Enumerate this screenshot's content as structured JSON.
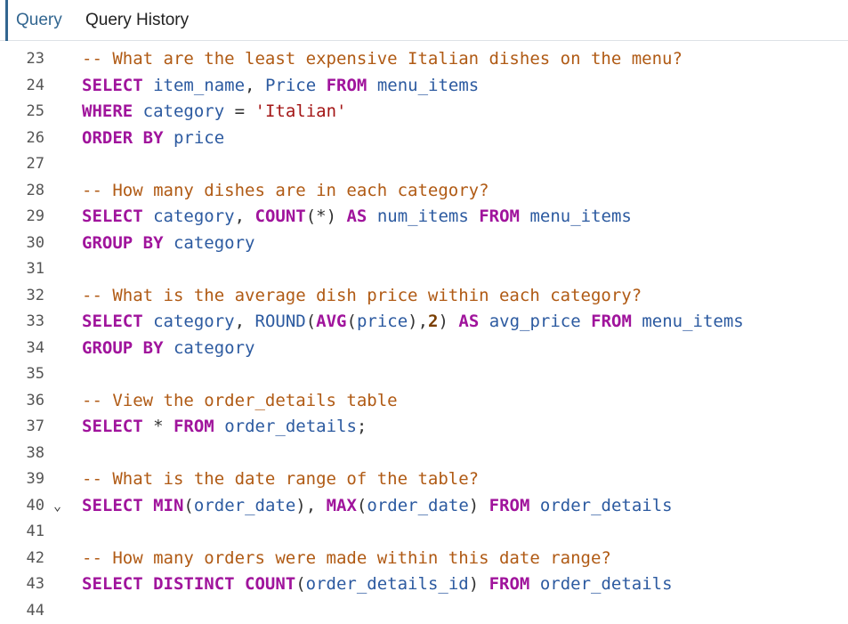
{
  "tabs": [
    {
      "label": "Query",
      "active": true
    },
    {
      "label": "Query History",
      "active": false
    }
  ],
  "colors": {
    "accent": "#326690",
    "comment": "#b05a14",
    "keyword": "#a0149c",
    "identifier": "#2c5aa0",
    "string": "#a31515"
  },
  "editor": {
    "lines": [
      {
        "num": "23",
        "tokens": [
          {
            "t": "comment",
            "v": "-- What are the least expensive Italian dishes on the menu?"
          }
        ]
      },
      {
        "num": "24",
        "tokens": [
          {
            "t": "keyword",
            "v": "SELECT"
          },
          {
            "t": "punct",
            "v": " "
          },
          {
            "t": "ident",
            "v": "item_name"
          },
          {
            "t": "punct",
            "v": ", "
          },
          {
            "t": "ident",
            "v": "Price"
          },
          {
            "t": "punct",
            "v": " "
          },
          {
            "t": "keyword",
            "v": "FROM"
          },
          {
            "t": "punct",
            "v": " "
          },
          {
            "t": "ident",
            "v": "menu_items"
          }
        ]
      },
      {
        "num": "25",
        "tokens": [
          {
            "t": "keyword",
            "v": "WHERE"
          },
          {
            "t": "punct",
            "v": " "
          },
          {
            "t": "ident",
            "v": "category"
          },
          {
            "t": "punct",
            "v": " = "
          },
          {
            "t": "string",
            "v": "'Italian'"
          }
        ]
      },
      {
        "num": "26",
        "tokens": [
          {
            "t": "keyword",
            "v": "ORDER BY"
          },
          {
            "t": "punct",
            "v": " "
          },
          {
            "t": "ident",
            "v": "price"
          }
        ]
      },
      {
        "num": "27",
        "tokens": []
      },
      {
        "num": "28",
        "tokens": [
          {
            "t": "comment",
            "v": "-- How many dishes are in each category?"
          }
        ]
      },
      {
        "num": "29",
        "tokens": [
          {
            "t": "keyword",
            "v": "SELECT"
          },
          {
            "t": "punct",
            "v": " "
          },
          {
            "t": "ident",
            "v": "category"
          },
          {
            "t": "punct",
            "v": ", "
          },
          {
            "t": "keyword",
            "v": "COUNT"
          },
          {
            "t": "punct",
            "v": "(*) "
          },
          {
            "t": "keyword",
            "v": "AS"
          },
          {
            "t": "punct",
            "v": " "
          },
          {
            "t": "ident",
            "v": "num_items"
          },
          {
            "t": "punct",
            "v": " "
          },
          {
            "t": "keyword",
            "v": "FROM"
          },
          {
            "t": "punct",
            "v": " "
          },
          {
            "t": "ident",
            "v": "menu_items"
          }
        ]
      },
      {
        "num": "30",
        "tokens": [
          {
            "t": "keyword",
            "v": "GROUP BY"
          },
          {
            "t": "punct",
            "v": " "
          },
          {
            "t": "ident",
            "v": "category"
          }
        ]
      },
      {
        "num": "31",
        "tokens": []
      },
      {
        "num": "32",
        "tokens": [
          {
            "t": "comment",
            "v": "-- What is the average dish price within each category?"
          }
        ]
      },
      {
        "num": "33",
        "tokens": [
          {
            "t": "keyword",
            "v": "SELECT"
          },
          {
            "t": "punct",
            "v": " "
          },
          {
            "t": "ident",
            "v": "category"
          },
          {
            "t": "punct",
            "v": ", "
          },
          {
            "t": "func",
            "v": "ROUND"
          },
          {
            "t": "punct",
            "v": "("
          },
          {
            "t": "keyword",
            "v": "AVG"
          },
          {
            "t": "punct",
            "v": "("
          },
          {
            "t": "ident",
            "v": "price"
          },
          {
            "t": "punct",
            "v": "),"
          },
          {
            "t": "number",
            "v": "2"
          },
          {
            "t": "punct",
            "v": ") "
          },
          {
            "t": "keyword",
            "v": "AS"
          },
          {
            "t": "punct",
            "v": " "
          },
          {
            "t": "ident",
            "v": "avg_price"
          },
          {
            "t": "punct",
            "v": " "
          },
          {
            "t": "keyword",
            "v": "FROM"
          },
          {
            "t": "punct",
            "v": " "
          },
          {
            "t": "ident",
            "v": "menu_items"
          }
        ]
      },
      {
        "num": "34",
        "tokens": [
          {
            "t": "keyword",
            "v": "GROUP BY"
          },
          {
            "t": "punct",
            "v": " "
          },
          {
            "t": "ident",
            "v": "category"
          }
        ]
      },
      {
        "num": "35",
        "tokens": []
      },
      {
        "num": "36",
        "tokens": [
          {
            "t": "comment",
            "v": "-- View the order_details table"
          }
        ]
      },
      {
        "num": "37",
        "tokens": [
          {
            "t": "keyword",
            "v": "SELECT"
          },
          {
            "t": "punct",
            "v": " * "
          },
          {
            "t": "keyword",
            "v": "FROM"
          },
          {
            "t": "punct",
            "v": " "
          },
          {
            "t": "ident",
            "v": "order_details"
          },
          {
            "t": "punct",
            "v": ";"
          }
        ]
      },
      {
        "num": "38",
        "tokens": []
      },
      {
        "num": "39",
        "tokens": [
          {
            "t": "comment",
            "v": "-- What is the date range of the table?"
          }
        ]
      },
      {
        "num": "40",
        "fold": "⌄",
        "tokens": [
          {
            "t": "keyword",
            "v": "SELECT"
          },
          {
            "t": "punct",
            "v": " "
          },
          {
            "t": "keyword",
            "v": "MIN"
          },
          {
            "t": "punct",
            "v": "("
          },
          {
            "t": "ident",
            "v": "order_date"
          },
          {
            "t": "punct",
            "v": "), "
          },
          {
            "t": "keyword",
            "v": "MAX"
          },
          {
            "t": "punct",
            "v": "("
          },
          {
            "t": "ident",
            "v": "order_date"
          },
          {
            "t": "punct",
            "v": ") "
          },
          {
            "t": "keyword",
            "v": "FROM"
          },
          {
            "t": "punct",
            "v": " "
          },
          {
            "t": "ident",
            "v": "order_details"
          }
        ]
      },
      {
        "num": "41",
        "tokens": []
      },
      {
        "num": "42",
        "tokens": [
          {
            "t": "comment",
            "v": "-- How many orders were made within this date range?"
          }
        ]
      },
      {
        "num": "43",
        "tokens": [
          {
            "t": "keyword",
            "v": "SELECT DISTINCT COUNT"
          },
          {
            "t": "punct",
            "v": "("
          },
          {
            "t": "ident",
            "v": "order_details_id"
          },
          {
            "t": "punct",
            "v": ") "
          },
          {
            "t": "keyword",
            "v": "FROM"
          },
          {
            "t": "punct",
            "v": " "
          },
          {
            "t": "ident",
            "v": "order_details"
          }
        ]
      },
      {
        "num": "44",
        "tokens": []
      }
    ]
  }
}
